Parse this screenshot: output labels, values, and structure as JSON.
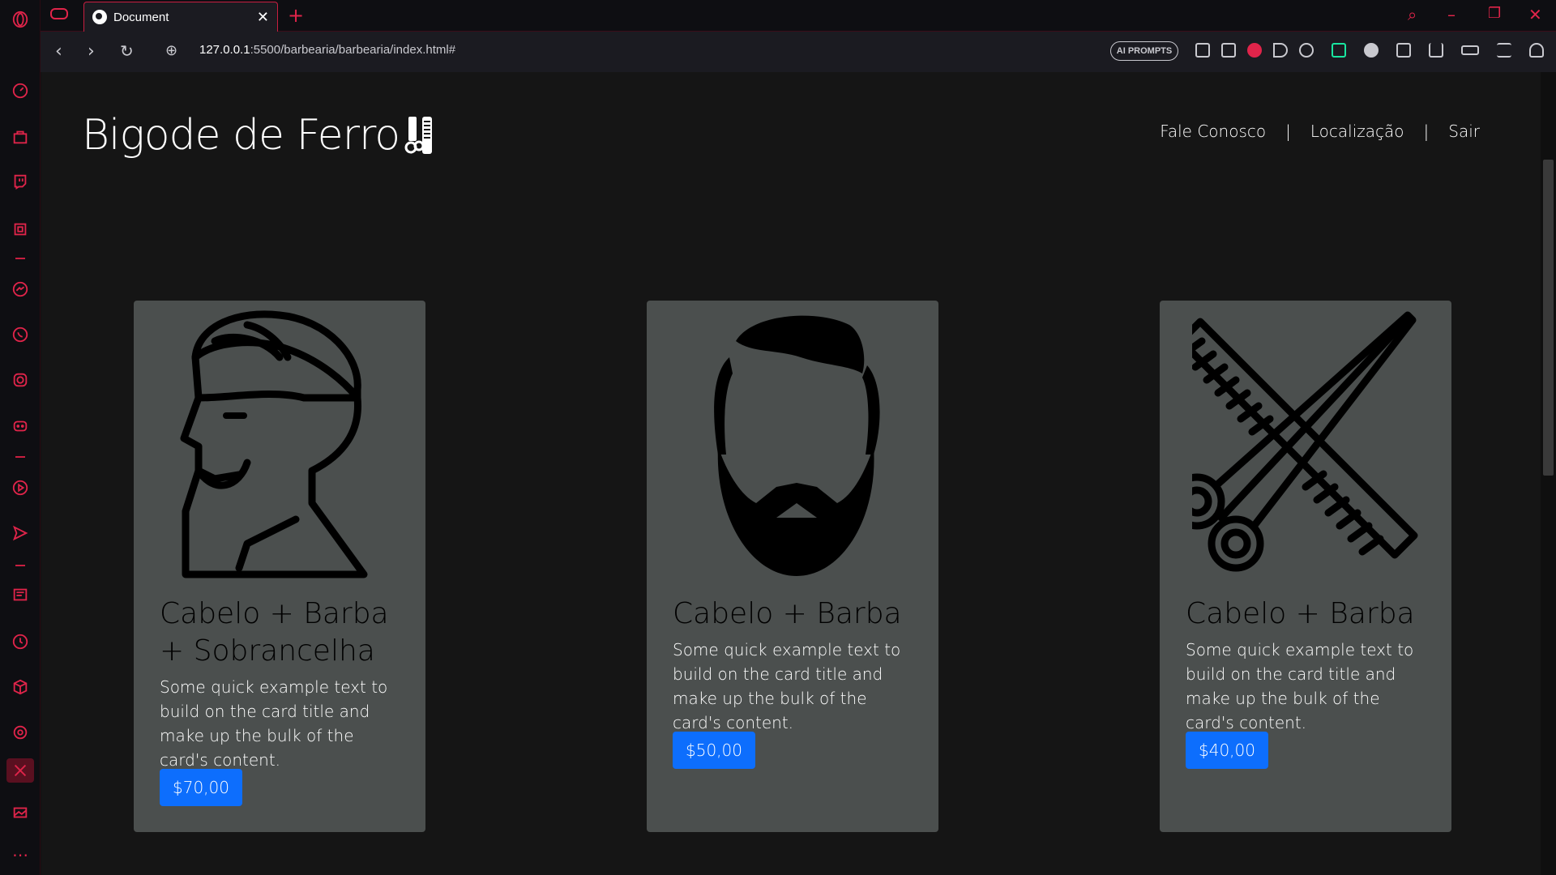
{
  "browser": {
    "tab_title": "Document",
    "url_host": "127.0.0.1",
    "url_path": ":5500/barbearia/barbearia/index.html#",
    "ai_prompts_label": "AI PROMPTS"
  },
  "header": {
    "brand": "Bigode de Ferro",
    "nav": [
      "Fale Conosco",
      "Localização",
      "Sair"
    ],
    "nav_separator": "|"
  },
  "cards": [
    {
      "icon": "man-profile-turban-icon",
      "title": "Cabelo + Barba + Sobrancelha",
      "text": "Some quick example text to build on the card title and make up the bulk of the card's content.",
      "price": "$70,00"
    },
    {
      "icon": "beard-face-icon",
      "title": "Cabelo + Barba",
      "text": "Some quick example text to build on the card title and make up the bulk of the card's content.",
      "price": "$50,00"
    },
    {
      "icon": "comb-scissors-icon",
      "title": "Cabelo + Barba",
      "text": "Some quick example text to build on the card title and make up the bulk of the card's content.",
      "price": "$40,00"
    }
  ],
  "colors": {
    "accent": "#e0244a",
    "card_bg": "#4b4f4e",
    "button": "#0d6efd",
    "page_bg": "#151515"
  }
}
